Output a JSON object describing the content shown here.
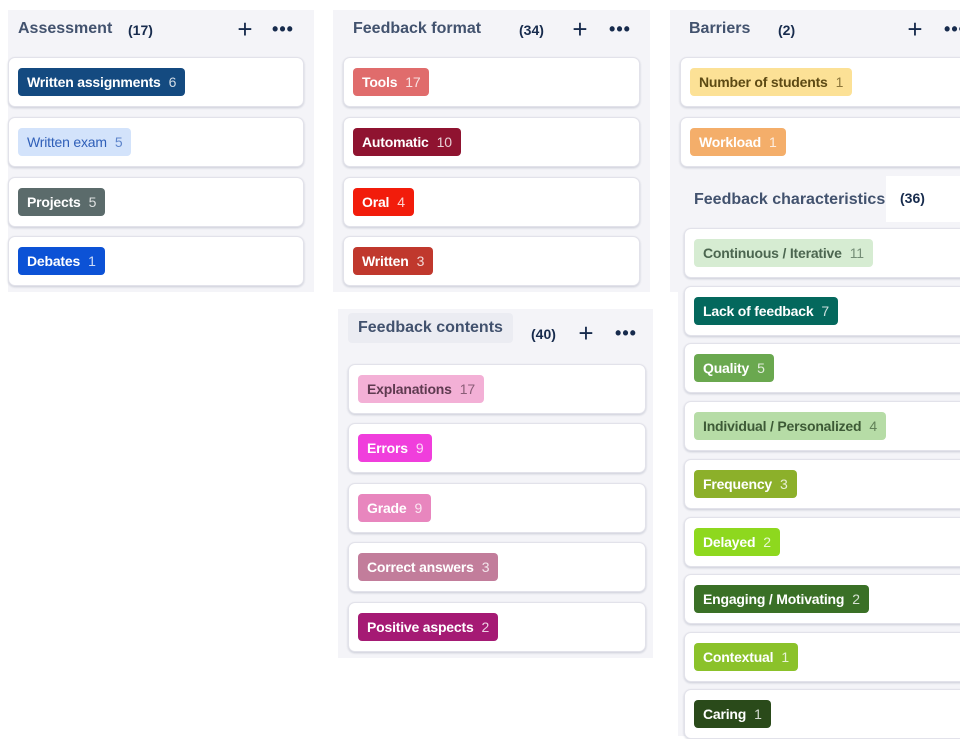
{
  "columns": {
    "assessment": {
      "title": "Assessment",
      "count": "(17)",
      "cards": [
        {
          "label": "Written assignments",
          "count": "6",
          "bg": "#144a80",
          "fg": "#ffffff"
        },
        {
          "label": "Written exam",
          "count": "5",
          "bg": "#d3e3fb",
          "fg": "#2f5fb8"
        },
        {
          "label": "Projects",
          "count": "5",
          "bg": "#5b6b6b",
          "fg": "#ffffff"
        },
        {
          "label": "Debates",
          "count": "1",
          "bg": "#0c52d6",
          "fg": "#ffffff"
        }
      ]
    },
    "feedback_format": {
      "title": "Feedback format",
      "count": "(34)",
      "cards": [
        {
          "label": "Tools",
          "count": "17",
          "bg": "#e06c6c",
          "fg": "#ffffff"
        },
        {
          "label": "Automatic",
          "count": "10",
          "bg": "#8f1330",
          "fg": "#ffffff"
        },
        {
          "label": "Oral",
          "count": "4",
          "bg": "#f21c0b",
          "fg": "#ffffff"
        },
        {
          "label": "Written",
          "count": "3",
          "bg": "#c0382d",
          "fg": "#ffffff"
        }
      ]
    },
    "feedback_contents": {
      "title": "Feedback contents",
      "count": "(40)",
      "cards": [
        {
          "label": "Explanations",
          "count": "17",
          "bg": "#f3b0d6",
          "fg": "#5e3a50"
        },
        {
          "label": "Errors",
          "count": "9",
          "bg": "#f03edc",
          "fg": "#ffffff"
        },
        {
          "label": "Grade",
          "count": "9",
          "bg": "#e886be",
          "fg": "#ffffff"
        },
        {
          "label": "Correct answers",
          "count": "3",
          "bg": "#c27d9b",
          "fg": "#ffffff"
        },
        {
          "label": "Positive aspects",
          "count": "2",
          "bg": "#a51a74",
          "fg": "#ffffff"
        }
      ]
    },
    "barriers": {
      "title": "Barriers",
      "count": "(2)",
      "cards": [
        {
          "label": "Number of students",
          "count": "1",
          "bg": "#fce196",
          "fg": "#5d4a14"
        },
        {
          "label": "Workload",
          "count": "1",
          "bg": "#f4ae6a",
          "fg": "#ffffff"
        }
      ]
    },
    "feedback_characteristics": {
      "title": "Feedback characteristics",
      "count": "(36)",
      "cards": [
        {
          "label": "Continuous / Iterative",
          "count": "11",
          "bg": "#d6ecd2",
          "fg": "#4c6650"
        },
        {
          "label": "Lack of feedback",
          "count": "7",
          "bg": "#04685d",
          "fg": "#ffffff"
        },
        {
          "label": "Quality",
          "count": "5",
          "bg": "#6aa84f",
          "fg": "#ffffff"
        },
        {
          "label": "Individual / Personalized",
          "count": "4",
          "bg": "#b6dca6",
          "fg": "#3d5a36"
        },
        {
          "label": "Frequency",
          "count": "3",
          "bg": "#8cb02a",
          "fg": "#ffffff"
        },
        {
          "label": "Delayed",
          "count": "2",
          "bg": "#8ed81e",
          "fg": "#ffffff"
        },
        {
          "label": "Engaging / Motivating",
          "count": "2",
          "bg": "#3a7026",
          "fg": "#ffffff"
        },
        {
          "label": "Contextual",
          "count": "1",
          "bg": "#8bc22a",
          "fg": "#ffffff"
        },
        {
          "label": "Caring",
          "count": "1",
          "bg": "#2a4a1a",
          "fg": "#ffffff"
        }
      ]
    }
  },
  "icons": {
    "plus": "+",
    "more": "•••"
  }
}
